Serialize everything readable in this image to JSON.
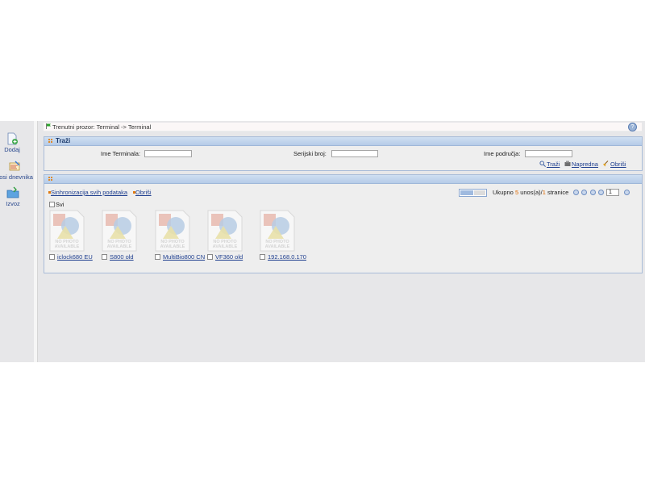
{
  "left_sidebar": {
    "items": [
      {
        "label": "Dodaj",
        "icon": "add-document-icon"
      },
      {
        "label": "posi dnevnika",
        "icon": "log-icon"
      },
      {
        "label": "Izvoz",
        "icon": "export-folder-icon"
      }
    ]
  },
  "breadcrumb": {
    "text": "Trenutni prozor: Terminal -> Terminal",
    "help_icon": "help-icon"
  },
  "search_panel": {
    "title": "Traži",
    "fields": [
      {
        "label": "Ime Terminala:",
        "value": ""
      },
      {
        "label": "Serijski broj:",
        "value": ""
      },
      {
        "label": "Ime područja:",
        "value": ""
      }
    ],
    "actions": {
      "search": "Traži",
      "advanced": "Napredna",
      "clear": "Obriši"
    }
  },
  "results_panel": {
    "sync_all": "Sinhronizacija svih podataka",
    "delete": "Obriši",
    "select_all": "Svi",
    "pagination": {
      "total_prefix": "Ukupno ",
      "total_count": "5",
      "total_mid": " unos(a)/",
      "page_count": "1",
      "total_suffix": " stranice",
      "current_page": "1"
    },
    "thumbnail_text": "NO PHOTO AVAILABLE",
    "devices": [
      {
        "name": "iclock680 EU"
      },
      {
        "name": "S800 old"
      },
      {
        "name": "MultiBio800 CN"
      },
      {
        "name": "VF360 old"
      },
      {
        "name": "192.168.0.170"
      }
    ]
  },
  "colors": {
    "accent": "#1f3f8f",
    "panel_header": "#c3d5ee",
    "highlight_count": "#e06a00"
  }
}
